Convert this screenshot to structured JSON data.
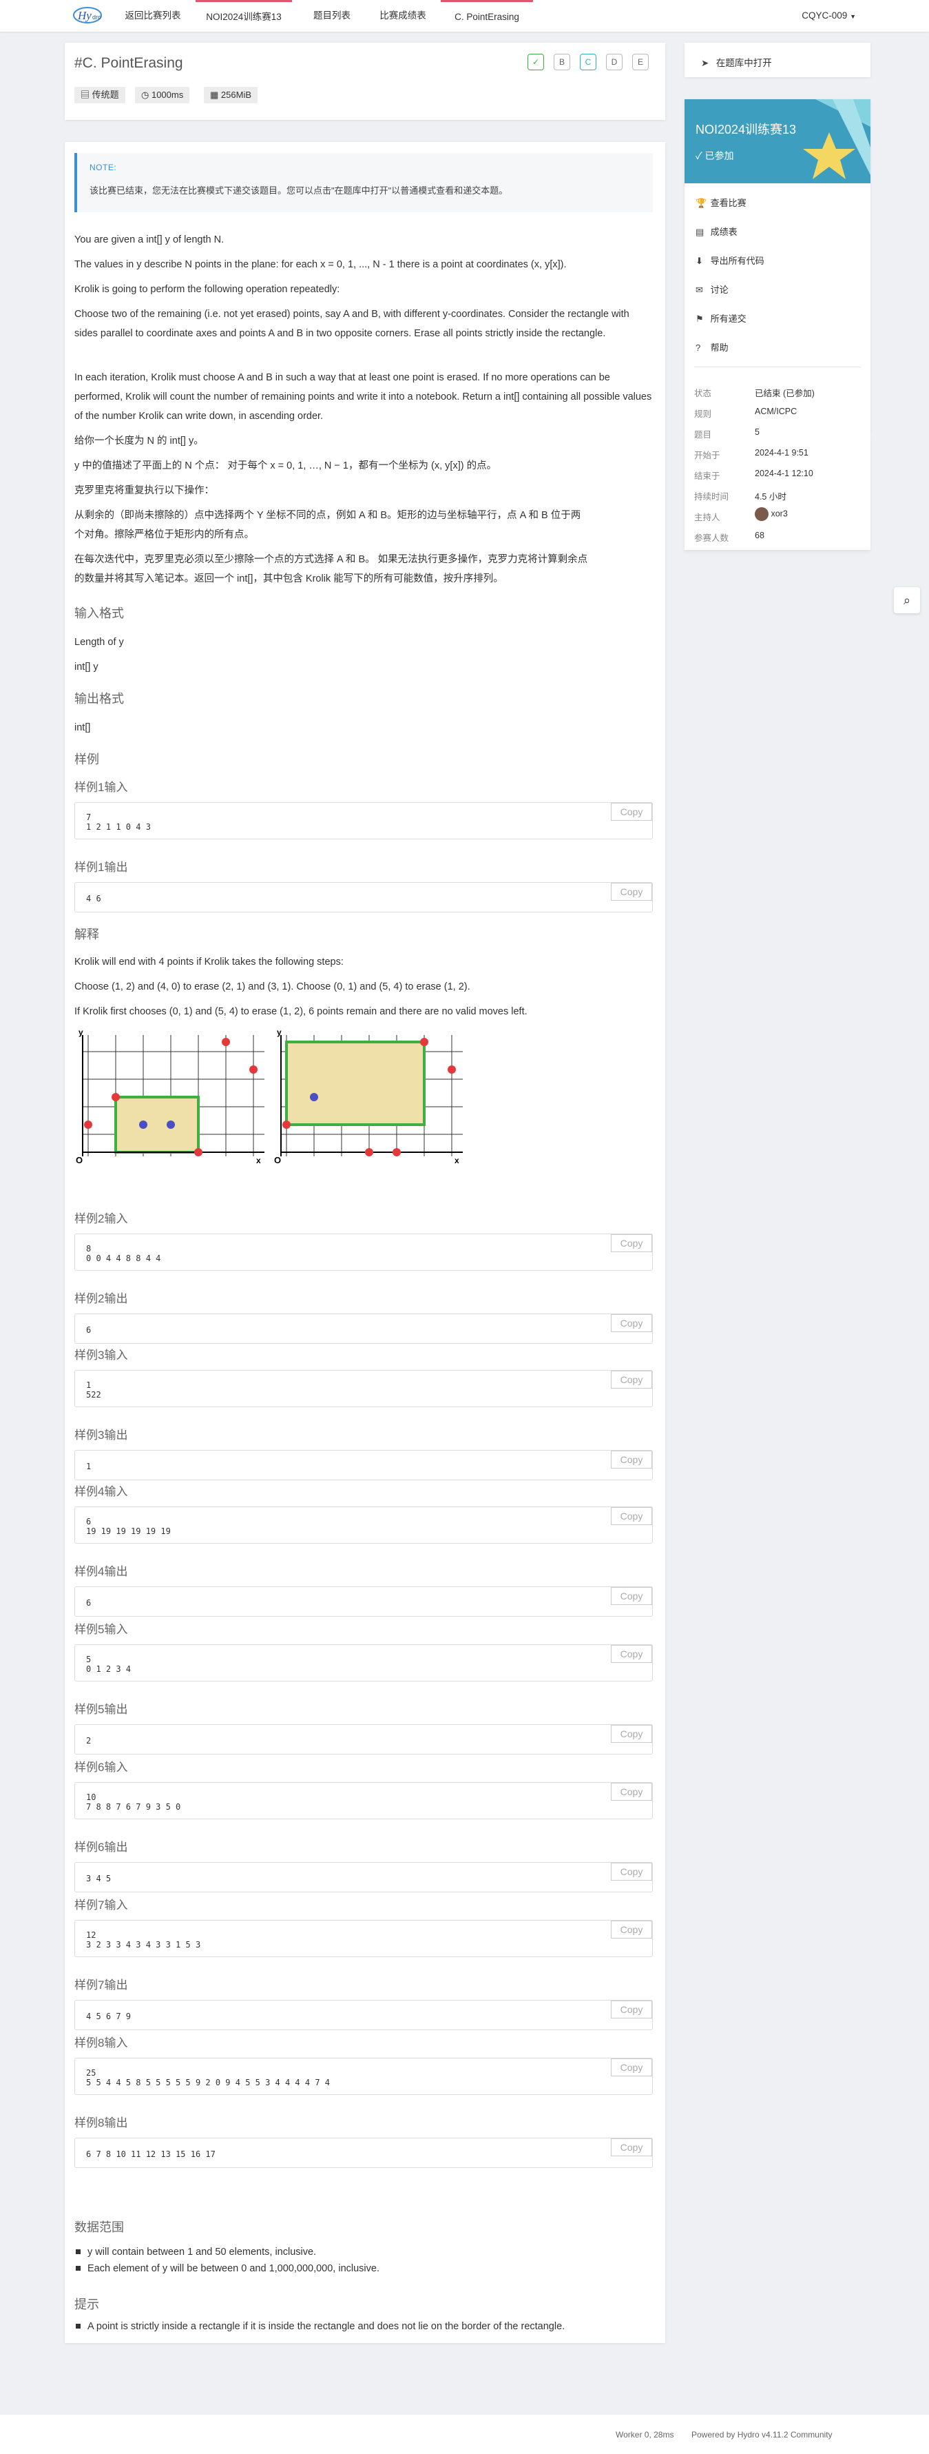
{
  "nav": {
    "back": "返回比赛列表",
    "contest": "NOI2024训练赛13",
    "problems": "题目列表",
    "scoreboard": "比赛成绩表",
    "current": "C. PointErasing",
    "user": "CQYC-009"
  },
  "problem": {
    "title": "#C. PointErasing",
    "type": "传统题",
    "time": "1000ms",
    "memory": "256MiB",
    "letters": [
      "B",
      "C",
      "D",
      "E"
    ]
  },
  "note": {
    "head": "NOTE:",
    "body": "该比赛已结束，您无法在比赛模式下递交该题目。您可以点击\"在题库中打开\"以普通模式查看和递交本题。"
  },
  "statement": {
    "p1": "You are given a int[] y of length N.",
    "p2": "The values in y describe N points in the plane: for each x = 0, 1, ..., N - 1 there is a point at coordinates (x, y[x]).",
    "p3": "Krolik is going to perform the following operation repeatedly:",
    "p4": "Choose two of the remaining (i.e. not yet erased) points, say A and B, with different y-coordinates. Consider the rectangle with sides parallel to coordinate axes and points A and B in two opposite corners. Erase all points strictly inside the rectangle.",
    "p5": "In each iteration, Krolik must choose A and B in such a way that at least one point is erased. If no more operations can be performed, Krolik will count the number of remaining points and write it into a notebook. Return a int[] containing all possible values of the number Krolik can write down, in ascending order.",
    "c1": "给你一个长度为 N 的 int[] y。",
    "c2": "y 中的值描述了平面上的 N 个点： 对于每个 x = 0, 1, …, N − 1，都有一个坐标为 (x, y[x]) 的点。",
    "c3": "克罗里克将重复执行以下操作：",
    "c4a": "从剩余的（即尚未擦除的）点中选择两个 Y 坐标不同的点，例如 A 和 B。矩形的边与坐标轴平行，点 A 和 B 位于两",
    "c4b": "个对角。擦除严格位于矩形内的所有点。",
    "c5a": "在每次迭代中，克罗里克必须以至少擦除一个点的方式选择 A 和 B。 如果无法执行更多操作，克罗力克将计算剩余点",
    "c5b": "的数量并将其写入笔记本。返回一个 int[]，其中包含 Krolik 能写下的所有可能数值，按升序排列。"
  },
  "input_format": {
    "head": "输入格式",
    "l1": "Length of y",
    "l2": "int[] y"
  },
  "output_format": {
    "head": "输出格式",
    "l1": "int[]"
  },
  "samples_head": "样例",
  "copy": "Copy",
  "samples": [
    {
      "in_label": "样例1输入",
      "in": "7\n1 2 1 1 0 4 3",
      "out_label": "样例1输出",
      "out": "4 6"
    },
    {
      "in_label": "样例2输入",
      "in": "8\n0 0 4 4 8 8 4 4",
      "out_label": "样例2输出",
      "out": "6"
    },
    {
      "in_label": "样例3输入",
      "in": "1\n522",
      "out_label": "样例3输出",
      "out": "1"
    },
    {
      "in_label": "样例4输入",
      "in": "6\n19 19 19 19 19 19",
      "out_label": "样例4输出",
      "out": "6"
    },
    {
      "in_label": "样例5输入",
      "in": "5\n0 1 2 3 4",
      "out_label": "样例5输出",
      "out": "2"
    },
    {
      "in_label": "样例6输入",
      "in": "10\n7 8 8 7 6 7 9 3 5 0",
      "out_label": "样例6输出",
      "out": "3 4 5"
    },
    {
      "in_label": "样例7输入",
      "in": "12\n3 2 3 3 4 3 4 3 3 1 5 3",
      "out_label": "样例7输出",
      "out": "4 5 6 7 9"
    },
    {
      "in_label": "样例8输入",
      "in": "25\n5 5 4 4 5 8 5 5 5 5 5 9 2 0 9 4 5 5 3 4 4 4 4 7 4",
      "out_label": "样例8输出",
      "out": "6 7 8 10 11 12 13 15 16 17"
    }
  ],
  "explain": {
    "head": "解释",
    "l1": "Krolik will end with 4 points if Krolik takes the following steps:",
    "l2": "Choose (1, 2) and (4, 0) to erase (2, 1) and (3, 1). Choose (0, 1) and (5, 4) to erase (1, 2).",
    "l3": "If Krolik first chooses (0, 1) and (5, 4) to erase (1, 2), 6 points remain and there are no valid moves left.",
    "axis_y": "y",
    "axis_x": "x",
    "origin": "O"
  },
  "limits": {
    "head": "数据范围",
    "l1": "y will contain between 1 and 50 elements, inclusive.",
    "l2": "Each element of y will be between 0 and 1,000,000,000, inclusive."
  },
  "hint": {
    "head": "提示",
    "l1": "A point is strictly inside a rectangle if it is inside the rectangle and does not lie on the border of the rectangle."
  },
  "sidebar": {
    "open": "在题库中打开",
    "contest": "NOI2024训练赛13",
    "joined": "✓ 已参加",
    "menu": [
      "查看比赛",
      "成绩表",
      "导出所有代码",
      "讨论",
      "所有递交",
      "帮助"
    ],
    "info": [
      [
        "状态",
        "已结束 (已参加)"
      ],
      [
        "规则",
        "ACM/ICPC"
      ],
      [
        "题目",
        "5"
      ],
      [
        "开始于",
        "2024-4-1 9:51"
      ],
      [
        "结束于",
        "2024-4-1 12:10"
      ],
      [
        "持续时间",
        "4.5 小时"
      ],
      [
        "主持人",
        "xor3"
      ],
      [
        "参赛人数",
        "68"
      ]
    ]
  },
  "footer": {
    "worker": "Worker 0, 28ms",
    "powered": "Powered by Hydro v4.11.2 Community"
  },
  "colors": {
    "accent": "#e0556f",
    "link": "#3b8fd6",
    "rect": "#3cb043",
    "fill": "#efdfa8",
    "red": "#e23a3a",
    "blue": "#4a4fc4"
  }
}
